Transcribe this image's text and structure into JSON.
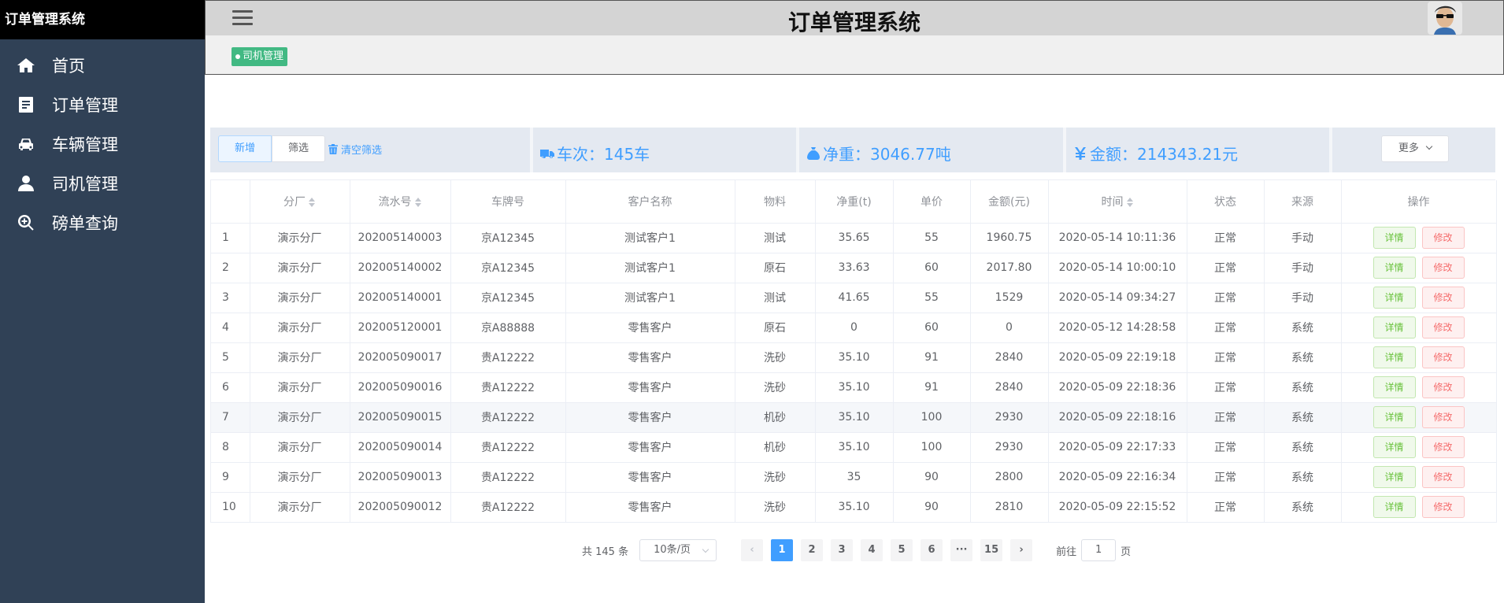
{
  "sidebar": {
    "brand": "订单管理系统",
    "items": [
      {
        "label": "首页",
        "icon": "home-icon"
      },
      {
        "label": "订单管理",
        "icon": "document-icon"
      },
      {
        "label": "车辆管理",
        "icon": "car-icon"
      },
      {
        "label": "司机管理",
        "icon": "user-icon"
      },
      {
        "label": "磅单查询",
        "icon": "zoom-in-icon"
      }
    ]
  },
  "header": {
    "title": "订单管理系统",
    "active_tag": "司机管理"
  },
  "toolbar": {
    "add_label": "新增",
    "filter_label": "筛选",
    "clear_filter_label": "清空筛选",
    "trips_text": "车次：145车",
    "weight_text": "净重：3046.77吨",
    "amount_text": "金额：214343.21元",
    "more_label": "更多",
    "accent_color": "#409eff"
  },
  "table": {
    "headers": [
      "",
      "分厂",
      "流水号",
      "车牌号",
      "客户名称",
      "物料",
      "净重(t)",
      "单价",
      "金额(元)",
      "时间",
      "状态",
      "来源",
      "操作"
    ],
    "detail_label": "详情",
    "edit_label": "修改",
    "rows": [
      [
        "1",
        "演示分厂",
        "202005140003",
        "京A12345",
        "测试客户1",
        "测试",
        "35.65",
        "55",
        "1960.75",
        "2020-05-14 10:11:36",
        "正常",
        "手动"
      ],
      [
        "2",
        "演示分厂",
        "202005140002",
        "京A12345",
        "测试客户1",
        "原石",
        "33.63",
        "60",
        "2017.80",
        "2020-05-14 10:00:10",
        "正常",
        "手动"
      ],
      [
        "3",
        "演示分厂",
        "202005140001",
        "京A12345",
        "测试客户1",
        "测试",
        "41.65",
        "55",
        "1529",
        "2020-05-14 09:34:27",
        "正常",
        "手动"
      ],
      [
        "4",
        "演示分厂",
        "202005120001",
        "京A88888",
        "零售客户",
        "原石",
        "0",
        "60",
        "0",
        "2020-05-12 14:28:58",
        "正常",
        "系统"
      ],
      [
        "5",
        "演示分厂",
        "202005090017",
        "贵A12222",
        "零售客户",
        "洗砂",
        "35.10",
        "91",
        "2840",
        "2020-05-09 22:19:18",
        "正常",
        "系统"
      ],
      [
        "6",
        "演示分厂",
        "202005090016",
        "贵A12222",
        "零售客户",
        "洗砂",
        "35.10",
        "91",
        "2840",
        "2020-05-09 22:18:36",
        "正常",
        "系统"
      ],
      [
        "7",
        "演示分厂",
        "202005090015",
        "贵A12222",
        "零售客户",
        "机砂",
        "35.10",
        "100",
        "2930",
        "2020-05-09 22:18:16",
        "正常",
        "系统"
      ],
      [
        "8",
        "演示分厂",
        "202005090014",
        "贵A12222",
        "零售客户",
        "机砂",
        "35.10",
        "100",
        "2930",
        "2020-05-09 22:17:33",
        "正常",
        "系统"
      ],
      [
        "9",
        "演示分厂",
        "202005090013",
        "贵A12222",
        "零售客户",
        "洗砂",
        "35",
        "90",
        "2800",
        "2020-05-09 22:16:34",
        "正常",
        "系统"
      ],
      [
        "10",
        "演示分厂",
        "202005090012",
        "贵A12222",
        "零售客户",
        "洗砂",
        "35.10",
        "90",
        "2810",
        "2020-05-09 22:15:52",
        "正常",
        "系统"
      ]
    ]
  },
  "pagination": {
    "total_text": "共 145 条",
    "page_size": "10条/页",
    "pages": [
      "1",
      "2",
      "3",
      "4",
      "5",
      "6",
      "···",
      "15"
    ],
    "current_page": "1",
    "goto_label": "前往",
    "goto_value": "1",
    "page_suffix": "页"
  }
}
